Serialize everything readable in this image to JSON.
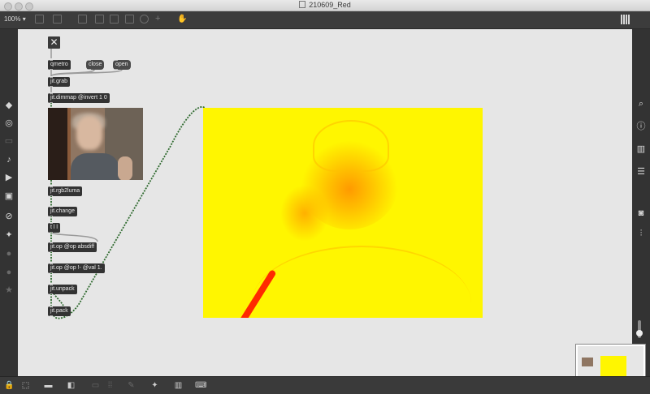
{
  "window": {
    "title": "210609_Red"
  },
  "toolbar": {
    "zoom": "100%",
    "zoom_arrow": "▾"
  },
  "patch": {
    "objects": [
      {
        "id": "qmetro",
        "label": "qmetro"
      },
      {
        "id": "close",
        "label": "close"
      },
      {
        "id": "open",
        "label": "open"
      },
      {
        "id": "jit_grab",
        "label": "jit.grab"
      },
      {
        "id": "jit_dimmap",
        "label": "jit.dimmap @invert 1 0"
      },
      {
        "id": "jit_rgb2luma",
        "label": "jit.rgb2luma"
      },
      {
        "id": "jit_change",
        "label": "jit.change"
      },
      {
        "id": "t_l_l",
        "label": "t l l"
      },
      {
        "id": "jit_op_absdiff",
        "label": "jit.op @op absdiff"
      },
      {
        "id": "jit_op_val",
        "label": "jit.op @op !- @val 1."
      },
      {
        "id": "jit_unpack",
        "label": "jit.unpack"
      },
      {
        "id": "jit_pack",
        "label": "jit.pack"
      }
    ],
    "toggle_glyph": "✕"
  },
  "left_sidebar": [
    "objects-icon",
    "circle-icon",
    "grid-icon",
    "note-icon",
    "play-icon",
    "image-icon",
    "paperclip-icon",
    "plug-icon",
    "p-icon",
    "b-icon",
    "star-icon"
  ],
  "right_sidebar": [
    "search-icon",
    "info-icon",
    "book-icon",
    "list-icon",
    "camera-icon",
    "mixer-icon"
  ],
  "colors": {
    "output_fill": "#fff600",
    "glow": "#ff9a00",
    "red_stroke": "#ff2a00",
    "canvas": "#e6e6e6"
  }
}
